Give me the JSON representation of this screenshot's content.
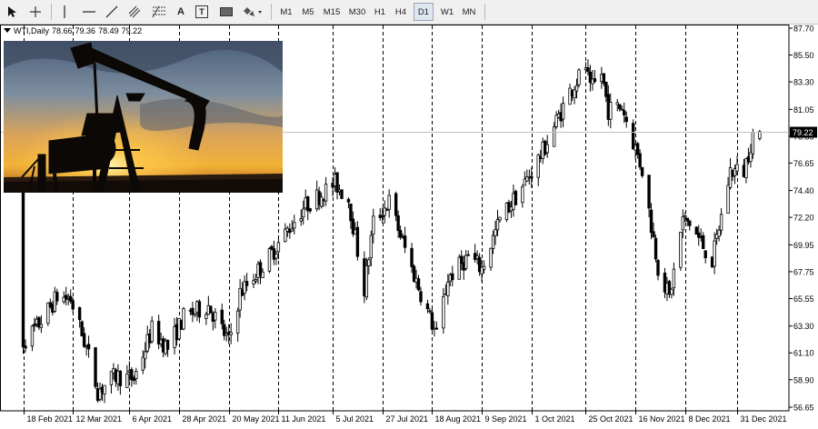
{
  "toolbar": {
    "tools": [
      {
        "name": "cursor-icon"
      },
      {
        "name": "crosshair-icon"
      },
      {
        "name": "vertical-line-icon"
      },
      {
        "name": "horizontal-line-icon"
      },
      {
        "name": "trendline-icon"
      },
      {
        "name": "equidistant-channel-icon"
      },
      {
        "name": "fibonacci-icon"
      },
      {
        "name": "text-icon",
        "label": "A"
      },
      {
        "name": "text-label-icon",
        "label": "T"
      },
      {
        "name": "rectangle-icon"
      },
      {
        "name": "shapes-menu-icon"
      }
    ],
    "timeframes": [
      "M1",
      "M5",
      "M15",
      "M30",
      "H1",
      "H4",
      "D1",
      "W1",
      "MN"
    ],
    "active_timeframe": "D1"
  },
  "symbol_header": {
    "symbol": "WTI,Daily",
    "open": "78.66",
    "high": "79.36",
    "low": "78.49",
    "close": "79.22"
  },
  "colors": {
    "candle_up_body": "#ffffff",
    "candle_down_body": "#000000",
    "candle_outline": "#000000",
    "grid": "#000000",
    "price_line": "#c0c0c0",
    "price_tag_bg": "#000000",
    "price_tag_text": "#ffffff"
  },
  "chart_data": {
    "type": "candlestick",
    "title": "WTI,Daily",
    "ylim": [
      56.65,
      87.7
    ],
    "y_ticks": [
      "87.70",
      "85.50",
      "83.30",
      "81.05",
      "78.85",
      "76.65",
      "74.40",
      "72.20",
      "69.95",
      "67.75",
      "65.55",
      "63.30",
      "61.10",
      "58.90",
      "56.65"
    ],
    "x_ticks": [
      "18 Feb 2021",
      "12 Mar 2021",
      "6 Apr 2021",
      "28 Apr 2021",
      "20 May 2021",
      "11 Jun 2021",
      "5 Jul 2021",
      "27 Jul 2021",
      "18 Aug 2021",
      "9 Sep 2021",
      "1 Oct 2021",
      "25 Oct 2021",
      "16 Nov 2021",
      "8 Dec 2021",
      "31 Dec 2021"
    ],
    "current_price": "79.22",
    "grid": "vertical-dashed",
    "anchors": [
      [
        "2021-02-18",
        62.0
      ],
      [
        "2021-02-24",
        63.2
      ],
      [
        "2021-03-05",
        65.7
      ],
      [
        "2021-03-11",
        65.5
      ],
      [
        "2021-03-18",
        61.5
      ],
      [
        "2021-03-23",
        58.0
      ],
      [
        "2021-03-31",
        59.2
      ],
      [
        "2021-04-08",
        59.0
      ],
      [
        "2021-04-16",
        63.0
      ],
      [
        "2021-04-23",
        61.5
      ],
      [
        "2021-04-30",
        64.0
      ],
      [
        "2021-05-11",
        65.0
      ],
      [
        "2021-05-20",
        62.0
      ],
      [
        "2021-05-25",
        66.0
      ],
      [
        "2021-06-07",
        69.0
      ],
      [
        "2021-06-22",
        73.0
      ],
      [
        "2021-07-06",
        75.0
      ],
      [
        "2021-07-12",
        73.7
      ],
      [
        "2021-07-19",
        66.3
      ],
      [
        "2021-07-23",
        71.8
      ],
      [
        "2021-07-30",
        73.5
      ],
      [
        "2021-08-09",
        68.0
      ],
      [
        "2021-08-20",
        62.5
      ],
      [
        "2021-08-25",
        67.2
      ],
      [
        "2021-09-03",
        69.0
      ],
      [
        "2021-09-09",
        68.0
      ],
      [
        "2021-09-17",
        72.0
      ],
      [
        "2021-09-28",
        75.0
      ],
      [
        "2021-10-06",
        77.6
      ],
      [
        "2021-10-18",
        82.5
      ],
      [
        "2021-10-25",
        84.6
      ],
      [
        "2021-10-27",
        82.5
      ],
      [
        "2021-11-01",
        84.0
      ],
      [
        "2021-11-04",
        81.0
      ],
      [
        "2021-11-10",
        81.3
      ],
      [
        "2021-11-19",
        76.1
      ],
      [
        "2021-11-26",
        68.2
      ],
      [
        "2021-12-01",
        65.6
      ],
      [
        "2021-12-07",
        72.0
      ],
      [
        "2021-12-10",
        71.7
      ],
      [
        "2021-12-20",
        68.6
      ],
      [
        "2021-12-28",
        76.0
      ],
      [
        "2022-01-03",
        76.0
      ],
      [
        "2022-01-07",
        79.0
      ],
      [
        "2022-01-10",
        79.22
      ]
    ]
  }
}
